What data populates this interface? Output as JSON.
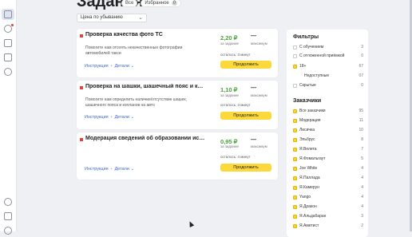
{
  "page": {
    "title": "Задания"
  },
  "tabs": [
    {
      "label": "Все"
    },
    {
      "label": "Избранное",
      "badge": "0"
    }
  ],
  "sort": {
    "value": "Цена по убыванию"
  },
  "cards": [
    {
      "title": "Проверка качества фото ТС",
      "desc": "Помогите нам отсеять некачественные фотографии автомобилей такси",
      "price": "2,20 ₽",
      "per": "за задание",
      "dash": "—",
      "min": "максимум",
      "left": "осталось: 3 минут",
      "button": "Продолжить",
      "link1": "Инструкция",
      "link2": "Детали ⌄"
    },
    {
      "title": "Проверка на шашки, шашечный пояс и кол...",
      "desc": "Помогите нам определить наличие/отсутствие шашек, шашечного пояса и копланов на авто",
      "price": "1,10 ₽",
      "per": "за задание",
      "dash": "—",
      "min": "максимум",
      "left": "осталось: 3 минут",
      "button": "Продолжить",
      "link1": "Инструкция",
      "link2": "Детали ⌄"
    },
    {
      "title": "Модерация сведений об образовании исполн...",
      "desc": "",
      "price": "0,95 ₽",
      "per": "за задание",
      "dash": "—",
      "min": "максимум",
      "left": "осталось: 4 минут",
      "button": "Продолжить",
      "link1": "Инструкция",
      "link2": "Детали ⌄"
    }
  ],
  "filters": {
    "title": "Фильтры",
    "items": [
      {
        "label": "С обучением",
        "count": "3",
        "checked": false,
        "indent": false
      },
      {
        "label": "С отложенной приёмкой",
        "count": "0",
        "checked": false,
        "indent": false
      },
      {
        "label": "18+",
        "count": "67",
        "checked": true,
        "indent": false
      },
      {
        "label": "Недоступные",
        "count": "07",
        "checked": false,
        "indent": true
      },
      {
        "label": "Скрытые",
        "count": "0",
        "checked": false,
        "indent": false
      }
    ]
  },
  "customers": {
    "title": "Заказчики",
    "items": [
      {
        "label": "Все заказчики",
        "count": "95"
      },
      {
        "label": "Модерация",
        "count": "11"
      },
      {
        "label": "Лисичка",
        "count": "10"
      },
      {
        "label": "Эльбрус",
        "count": "8"
      },
      {
        "label": "Я.Велета",
        "count": "7"
      },
      {
        "label": "Я.Фомальгаут",
        "count": "5"
      },
      {
        "label": "Joe White",
        "count": "4"
      },
      {
        "label": "Я.Паллада",
        "count": "4"
      },
      {
        "label": "Я.Камерун",
        "count": "4"
      },
      {
        "label": "Yango",
        "count": "4"
      },
      {
        "label": "Я.Дракон",
        "count": "4"
      },
      {
        "label": "Я.Альдабаран",
        "count": "3"
      },
      {
        "label": "Я.Аметист",
        "count": "2"
      }
    ]
  },
  "colors": {
    "accent": "#fcd83c",
    "price": "#4aa33a",
    "link": "#3d68c9",
    "flag": "#e8413d"
  }
}
